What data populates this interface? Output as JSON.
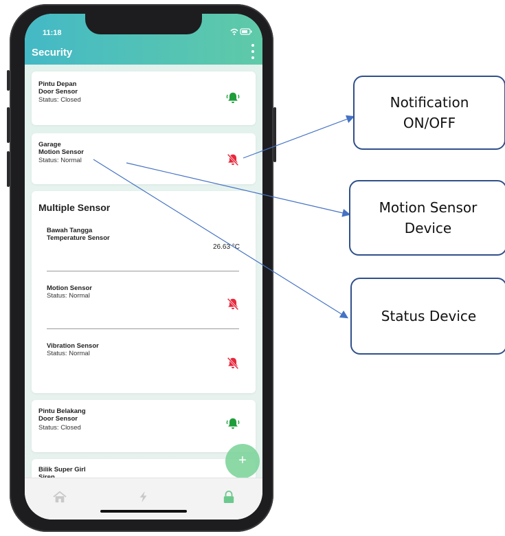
{
  "status_bar": {
    "time": "11:18",
    "icons": "●● ▯"
  },
  "app_bar": {
    "title": "Security"
  },
  "cards": [
    {
      "name_line1": "Pintu Depan",
      "name_line2": "Door Sensor",
      "status": "Status: Closed",
      "notification": "on"
    },
    {
      "name_line1": "Garage",
      "name_line2": "Motion Sensor",
      "status": "Status: Normal",
      "notification": "off"
    }
  ],
  "multiple_sensor": {
    "title": "Multiple Sensor",
    "items": [
      {
        "name_line1": "Bawah Tangga",
        "name_line2": "Temperature Sensor",
        "value": "26.63 °C"
      },
      {
        "name_line1": "Motion Sensor",
        "status": "Status: Normal",
        "notification": "off"
      },
      {
        "name_line1": "Vibration Sensor",
        "status": "Status: Normal",
        "notification": "off"
      }
    ]
  },
  "cards_lower": [
    {
      "name_line1": "Pintu Belakang",
      "name_line2": "Door Sensor",
      "status": "Status: Closed",
      "notification": "on"
    },
    {
      "name_line1": "Bilik Super Girl",
      "name_line2": "Siren"
    }
  ],
  "fab": {
    "label": "+"
  },
  "callouts": {
    "notification": [
      "Notification",
      "ON/OFF"
    ],
    "motion": [
      "Motion Sensor",
      "Device"
    ],
    "status": [
      "Status Device"
    ]
  },
  "colors": {
    "bell_on": "#1e9e3a",
    "bell_off": "#e8283c",
    "appbar_start": "#44b9c6",
    "appbar_end": "#5fcaa8",
    "arrow": "#4472c4"
  }
}
